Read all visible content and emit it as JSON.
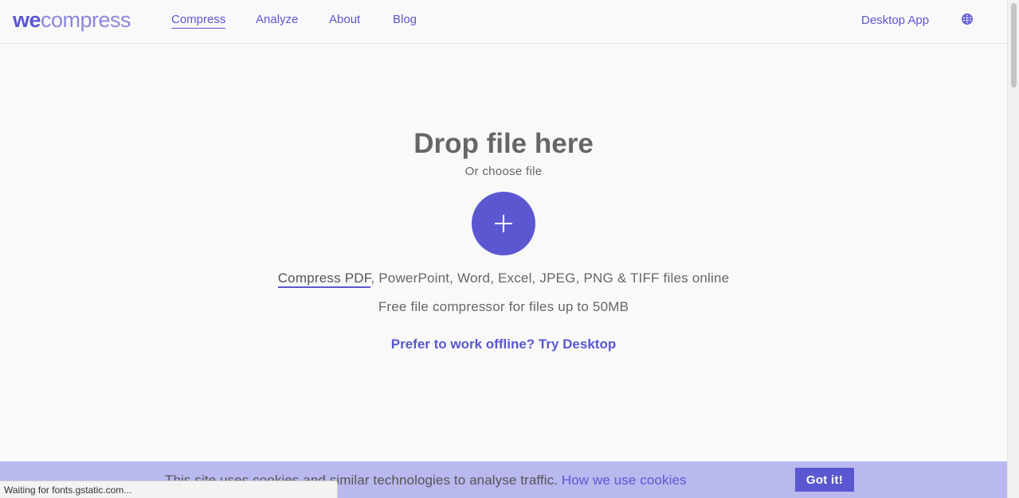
{
  "logo": {
    "part1": "we",
    "part2": "compress"
  },
  "nav": {
    "compress": "Compress",
    "analyze": "Analyze",
    "about": "About",
    "blog": "Blog",
    "desktop_app": "Desktop App",
    "language_icon": "globe-icon"
  },
  "main": {
    "drop_title": "Drop file here",
    "choose_file": "Or choose file",
    "add_icon": "plus-icon",
    "compress_pdf_link": "Compress PDF",
    "formats_rest": ", PowerPoint, Word, Excel, JPEG, PNG & TIFF files online",
    "free_text": "Free file compressor for files up to 50MB",
    "offline_link": "Prefer to work offline? Try Desktop"
  },
  "cookie": {
    "text": "This site uses cookies and similar technologies to analyse traffic. ",
    "link": "How we use cookies",
    "button": "Got it!"
  },
  "status_bar": {
    "text": "Waiting for fonts.gstatic.com..."
  },
  "colors": {
    "accent": "#5b57d1",
    "logo_light": "#8b88dc",
    "cookie_bg": "#b9b8ef",
    "page_bg": "#f9f9fa"
  }
}
